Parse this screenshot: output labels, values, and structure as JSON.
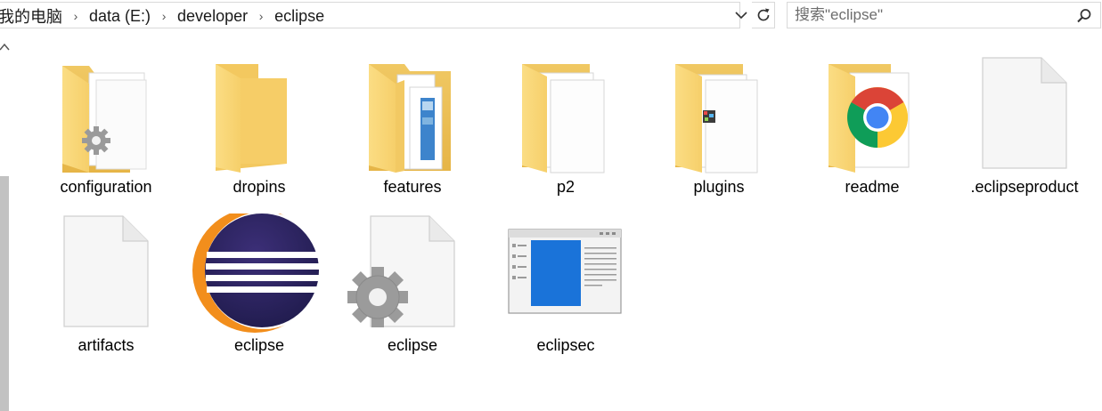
{
  "address_bar": {
    "breadcrumbs": [
      "我的电脑",
      "data (E:)",
      "developer",
      "eclipse"
    ]
  },
  "search": {
    "placeholder": "搜索\"eclipse\""
  },
  "files": [
    {
      "name": "configuration",
      "icon": "folder-settings-icon"
    },
    {
      "name": "dropins",
      "icon": "folder-icon"
    },
    {
      "name": "features",
      "icon": "folder-documents-icon"
    },
    {
      "name": "p2",
      "icon": "folder-files-icon"
    },
    {
      "name": "plugins",
      "icon": "folder-images-icon"
    },
    {
      "name": "readme",
      "icon": "chrome-folder-icon"
    },
    {
      "name": ".eclipseproduct",
      "icon": "blank-file-icon"
    },
    {
      "name": "artifacts",
      "icon": "blank-file-icon"
    },
    {
      "name": "eclipse",
      "icon": "eclipse-app-icon"
    },
    {
      "name": "eclipse",
      "icon": "config-file-icon"
    },
    {
      "name": "eclipsec",
      "icon": "window-app-icon"
    }
  ]
}
